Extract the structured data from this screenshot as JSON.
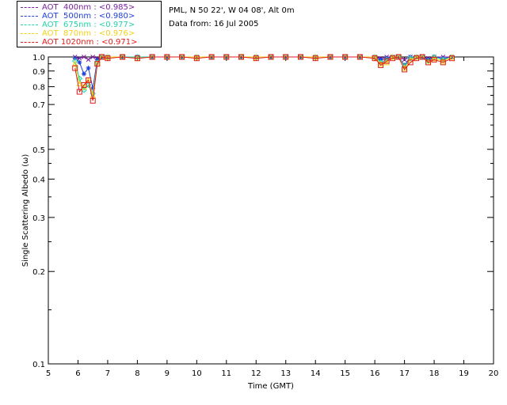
{
  "header": {
    "site_line": "PML, N 50 22', W 04 08', Alt 0m",
    "date_line": "Data from: 16 Jul 2005"
  },
  "legend": [
    {
      "label": "AOT  400nm : <0.985>",
      "color": "#7a1fa2"
    },
    {
      "label": "AOT  500nm : <0.980>",
      "color": "#1f3fd6"
    },
    {
      "label": "AOT  675nm : <0.977>",
      "color": "#22d3a8"
    },
    {
      "label": "AOT  870nm : <0.976>",
      "color": "#f2d21a"
    },
    {
      "label": "AOT 1020nm : <0.971>",
      "color": "#e01b1b"
    }
  ],
  "chart_data": {
    "type": "scatter",
    "xlabel": "Time (GMT)",
    "ylabel": "Single Scattering Albedo (ω)",
    "xlim": [
      5,
      20
    ],
    "ylim": [
      0.1,
      1.0
    ],
    "yscale": "log",
    "xticks": [
      "5",
      "6",
      "7",
      "8",
      "9",
      "10",
      "11",
      "12",
      "13",
      "14",
      "15",
      "16",
      "17",
      "18",
      "19",
      "20"
    ],
    "yticks": [
      {
        "value": 1.0,
        "label": "1.0"
      },
      {
        "value": 0.9,
        "label": "0.9"
      },
      {
        "value": 0.8,
        "label": "0.8"
      },
      {
        "value": 0.7,
        "label": "0.7"
      },
      {
        "value": 0.5,
        "label": "0.5"
      },
      {
        "value": 0.4,
        "label": "0.4"
      },
      {
        "value": 0.3,
        "label": "0.3"
      },
      {
        "value": 0.2,
        "label": "0.2"
      },
      {
        "value": 0.1,
        "label": "0.1"
      }
    ],
    "series": [
      {
        "name": "AOT  400nm",
        "color": "#7a1fa2",
        "marker": "x",
        "x": [
          5.9,
          6.05,
          6.2,
          6.35,
          6.5,
          6.65,
          6.8,
          7.0,
          7.5,
          8.0,
          8.5,
          9.0,
          9.5,
          10.0,
          10.5,
          11.0,
          11.5,
          12.0,
          12.5,
          13.0,
          13.5,
          14.0,
          14.5,
          15.0,
          15.5,
          16.0,
          16.2,
          16.4,
          16.6,
          16.8,
          17.0,
          17.2,
          17.4,
          17.6,
          17.8,
          18.0,
          18.3,
          18.6
        ],
        "y": [
          1.0,
          0.99,
          1.0,
          0.98,
          1.0,
          0.99,
          1.0,
          1.0,
          1.0,
          1.0,
          1.0,
          1.0,
          1.0,
          1.0,
          1.0,
          1.0,
          1.0,
          1.0,
          1.0,
          1.0,
          1.0,
          1.0,
          1.0,
          1.0,
          1.0,
          1.0,
          0.99,
          1.0,
          1.0,
          1.0,
          0.98,
          1.0,
          1.0,
          1.0,
          0.99,
          1.0,
          1.0,
          1.0
        ]
      },
      {
        "name": "AOT  500nm",
        "color": "#1f3fd6",
        "marker": "asterisk",
        "x": [
          5.9,
          6.05,
          6.2,
          6.35,
          6.5,
          6.65,
          6.8,
          7.0,
          7.5,
          8.0,
          8.5,
          9.0,
          9.5,
          10.0,
          10.5,
          11.0,
          11.5,
          12.0,
          12.5,
          13.0,
          13.5,
          14.0,
          14.5,
          15.0,
          15.5,
          16.0,
          16.2,
          16.4,
          16.6,
          16.8,
          17.0,
          17.2,
          17.4,
          17.6,
          17.8,
          18.0,
          18.3,
          18.6
        ],
        "y": [
          0.99,
          0.96,
          0.88,
          0.92,
          0.79,
          0.98,
          1.0,
          1.0,
          1.0,
          1.0,
          1.0,
          1.0,
          1.0,
          1.0,
          1.0,
          1.0,
          1.0,
          1.0,
          1.0,
          1.0,
          1.0,
          1.0,
          1.0,
          1.0,
          1.0,
          1.0,
          0.98,
          0.99,
          1.0,
          1.0,
          0.94,
          1.0,
          1.0,
          1.0,
          0.98,
          1.0,
          0.99,
          1.0
        ]
      },
      {
        "name": "AOT  675nm",
        "color": "#22d3a8",
        "marker": "diamond",
        "x": [
          5.9,
          6.05,
          6.2,
          6.35,
          6.5,
          6.65,
          6.8,
          7.0,
          7.5,
          8.0,
          8.5,
          9.0,
          9.5,
          10.0,
          10.5,
          11.0,
          11.5,
          12.0,
          12.5,
          13.0,
          13.5,
          14.0,
          14.5,
          15.0,
          15.5,
          16.0,
          16.2,
          16.4,
          16.6,
          16.8,
          17.0,
          17.2,
          17.4,
          17.6,
          17.8,
          18.0,
          18.3,
          18.6
        ],
        "y": [
          0.97,
          0.85,
          0.78,
          0.81,
          0.76,
          0.96,
          1.0,
          1.0,
          1.0,
          1.0,
          1.0,
          1.0,
          1.0,
          1.0,
          1.0,
          1.0,
          1.0,
          1.0,
          1.0,
          1.0,
          1.0,
          1.0,
          1.0,
          1.0,
          1.0,
          1.0,
          0.96,
          0.98,
          1.0,
          1.0,
          0.93,
          0.99,
          1.0,
          1.0,
          0.97,
          1.0,
          0.98,
          1.0
        ]
      },
      {
        "name": "AOT  870nm",
        "color": "#f2d21a",
        "marker": "triangle",
        "x": [
          5.9,
          6.05,
          6.2,
          6.35,
          6.5,
          6.65,
          6.8,
          7.0,
          7.5,
          8.0,
          8.5,
          9.0,
          9.5,
          10.0,
          10.5,
          11.0,
          11.5,
          12.0,
          12.5,
          13.0,
          13.5,
          14.0,
          14.5,
          15.0,
          15.5,
          16.0,
          16.2,
          16.4,
          16.6,
          16.8,
          17.0,
          17.2,
          17.4,
          17.6,
          17.8,
          18.0,
          18.3,
          18.6
        ],
        "y": [
          0.95,
          0.82,
          0.8,
          0.84,
          0.75,
          0.95,
          1.0,
          1.0,
          1.0,
          0.99,
          1.0,
          1.0,
          1.0,
          1.0,
          1.0,
          1.0,
          1.0,
          1.0,
          1.0,
          1.0,
          1.0,
          1.0,
          1.0,
          1.0,
          1.0,
          1.0,
          0.95,
          0.96,
          1.0,
          1.0,
          0.92,
          0.98,
          1.0,
          1.0,
          0.96,
          0.99,
          0.97,
          1.0
        ]
      },
      {
        "name": "AOT 1020nm",
        "color": "#e01b1b",
        "marker": "square",
        "x": [
          5.9,
          6.05,
          6.2,
          6.35,
          6.5,
          6.65,
          6.8,
          7.0,
          7.5,
          8.0,
          8.5,
          9.0,
          9.5,
          10.0,
          10.5,
          11.0,
          11.5,
          12.0,
          12.5,
          13.0,
          13.5,
          14.0,
          14.5,
          15.0,
          15.5,
          16.0,
          16.2,
          16.4,
          16.6,
          16.8,
          17.0,
          17.2,
          17.4,
          17.6,
          17.8,
          18.0,
          18.3,
          18.6
        ],
        "y": [
          0.92,
          0.77,
          0.81,
          0.84,
          0.72,
          0.95,
          1.0,
          0.99,
          1.0,
          0.99,
          1.0,
          1.0,
          1.0,
          0.99,
          1.0,
          1.0,
          1.0,
          0.99,
          1.0,
          1.0,
          1.0,
          0.99,
          1.0,
          1.0,
          1.0,
          0.99,
          0.94,
          0.97,
          0.99,
          1.0,
          0.91,
          0.96,
          0.99,
          1.0,
          0.96,
          0.98,
          0.96,
          0.99
        ]
      }
    ]
  }
}
